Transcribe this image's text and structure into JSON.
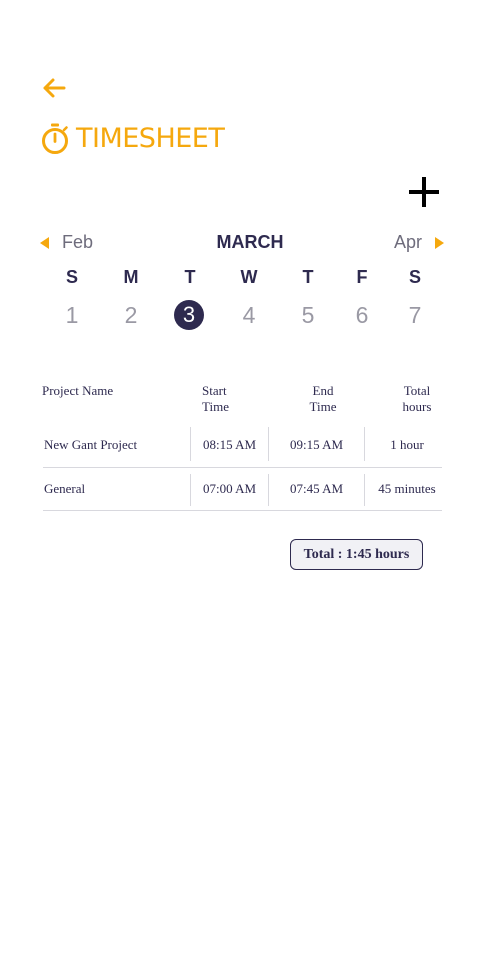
{
  "header": {
    "title": "TIMESHEET"
  },
  "calendar": {
    "month": "MARCH",
    "prev_month": "Feb",
    "next_month": "Apr",
    "weekdays": [
      "S",
      "M",
      "T",
      "W",
      "T",
      "F",
      "S"
    ],
    "days": [
      "1",
      "2",
      "3",
      "4",
      "5",
      "6",
      "7"
    ],
    "selected_day": "3"
  },
  "table": {
    "headers": {
      "project": "Project Name",
      "start": [
        "Start",
        "Time"
      ],
      "end": [
        "End",
        "Time"
      ],
      "total": [
        "Total",
        "hours"
      ]
    },
    "rows": [
      {
        "project": "New Gant Project",
        "start": "08:15 AM",
        "end": "09:15 AM",
        "hours": "1 hour"
      },
      {
        "project": "General",
        "start": "07:00 AM",
        "end": "07:45 AM",
        "hours": "45 minutes"
      }
    ]
  },
  "total_label": "Total : 1:45 hours",
  "colors": {
    "accent": "#f5a80e",
    "primary": "#2e2a4f",
    "muted": "#9a99a4"
  }
}
